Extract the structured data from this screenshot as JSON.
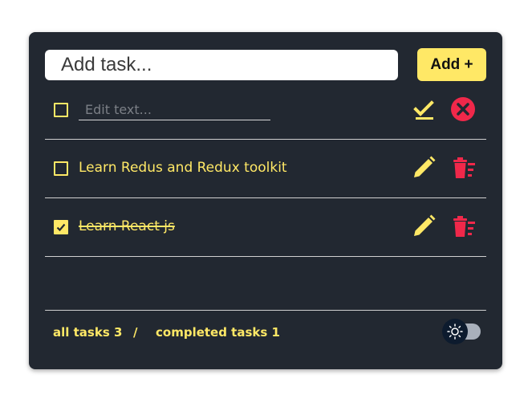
{
  "add_task": {
    "placeholder": "Add task...",
    "button_label": "Add +"
  },
  "tasks": [
    {
      "mode": "editing",
      "placeholder": "Edit text...",
      "value": "",
      "checked": false,
      "actions": [
        "check-icon",
        "close-circle-icon"
      ]
    },
    {
      "mode": "view",
      "text": "Learn Redus and Redux toolkit",
      "checked": false,
      "actions": [
        "pencil-icon",
        "trash-icon"
      ]
    },
    {
      "mode": "view",
      "text": "Learn React js",
      "checked": true,
      "actions": [
        "pencil-icon",
        "trash-icon"
      ]
    }
  ],
  "footer": {
    "all_tasks": "all tasks 3",
    "separator": "/",
    "completed_tasks": "completed tasks 1"
  },
  "theme_toggle": {
    "icon": "sun-icon",
    "state": "dark"
  },
  "colors": {
    "background": "#222831",
    "accent": "#ffe866",
    "danger": "#f0284a",
    "divider": "#d0d0d0"
  }
}
